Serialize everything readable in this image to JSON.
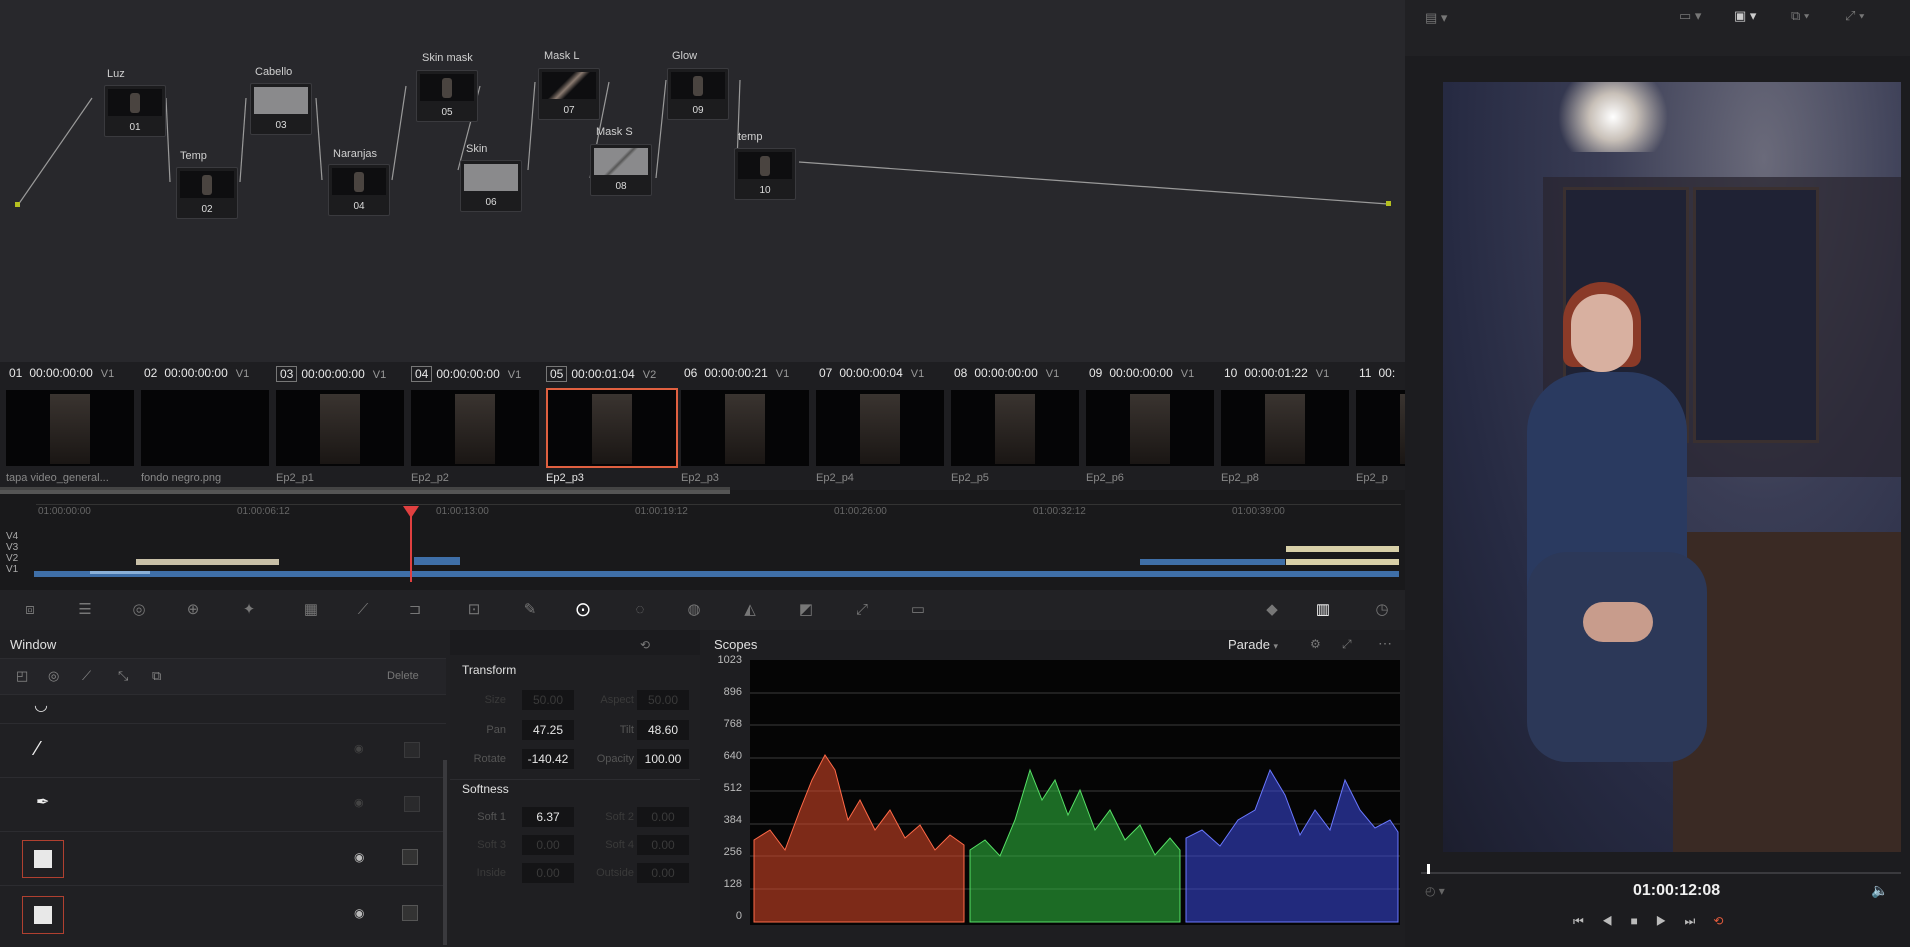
{
  "nodes": [
    {
      "label": "Luz",
      "num": "01"
    },
    {
      "label": "Temp",
      "num": "02"
    },
    {
      "label": "Cabello",
      "num": "03"
    },
    {
      "label": "Naranjas",
      "num": "04"
    },
    {
      "label": "Skin mask",
      "num": "05"
    },
    {
      "label": "Skin",
      "num": "06"
    },
    {
      "label": "Mask L",
      "num": "07"
    },
    {
      "label": "Mask S",
      "num": "08"
    },
    {
      "label": "Glow",
      "num": "09"
    },
    {
      "label": "temp",
      "num": "10"
    }
  ],
  "clips": [
    {
      "num": "01",
      "tc": "00:00:00:00",
      "track": "V1",
      "name": "tapa video_general..."
    },
    {
      "num": "02",
      "tc": "00:00:00:00",
      "track": "V1",
      "name": "fondo negro.png"
    },
    {
      "num": "03",
      "tc": "00:00:00:00",
      "track": "V1",
      "name": "Ep2_p1"
    },
    {
      "num": "04",
      "tc": "00:00:00:00",
      "track": "V1",
      "name": "Ep2_p2"
    },
    {
      "num": "05",
      "tc": "00:00:01:04",
      "track": "V2",
      "name": "Ep2_p3"
    },
    {
      "num": "06",
      "tc": "00:00:00:21",
      "track": "V1",
      "name": "Ep2_p3"
    },
    {
      "num": "07",
      "tc": "00:00:00:04",
      "track": "V1",
      "name": "Ep2_p4"
    },
    {
      "num": "08",
      "tc": "00:00:00:00",
      "track": "V1",
      "name": "Ep2_p5"
    },
    {
      "num": "09",
      "tc": "00:00:00:00",
      "track": "V1",
      "name": "Ep2_p6"
    },
    {
      "num": "10",
      "tc": "00:00:01:22",
      "track": "V1",
      "name": "Ep2_p8"
    },
    {
      "num": "11",
      "tc": "00:",
      "track": "",
      "name": "Ep2_p"
    }
  ],
  "ruler": [
    "01:00:00:00",
    "01:00:06:12",
    "01:00:13:00",
    "01:00:19:12",
    "01:00:26:00",
    "01:00:32:12",
    "01:00:39:00"
  ],
  "tracks": [
    "V4",
    "V3",
    "V2",
    "V1"
  ],
  "window_panel": {
    "title": "Window",
    "delete": "Delete"
  },
  "transform": {
    "title": "Transform",
    "size_label": "Size",
    "size": "50.00",
    "aspect_label": "Aspect",
    "aspect": "50.00",
    "pan_label": "Pan",
    "pan": "47.25",
    "tilt_label": "Tilt",
    "tilt": "48.60",
    "rotate_label": "Rotate",
    "rotate": "-140.42",
    "opacity_label": "Opacity",
    "opacity": "100.00"
  },
  "softness": {
    "title": "Softness",
    "soft1_label": "Soft 1",
    "soft1": "6.37",
    "soft2_label": "Soft 2",
    "soft2": "0.00",
    "soft3_label": "Soft 3",
    "soft3": "0.00",
    "soft4_label": "Soft 4",
    "soft4": "0.00",
    "inside_label": "Inside",
    "inside": "0.00",
    "outside_label": "Outside",
    "outside": "0.00"
  },
  "scopes": {
    "title": "Scopes",
    "mode": "Parade",
    "levels": [
      "1023",
      "896",
      "768",
      "640",
      "512",
      "384",
      "256",
      "128",
      "0"
    ]
  },
  "viewer": {
    "timecode": "01:00:12:08"
  },
  "colors": {
    "accent": "#e05a3c",
    "red": "#e04828",
    "green": "#30c040",
    "blue": "#3a48e0"
  }
}
